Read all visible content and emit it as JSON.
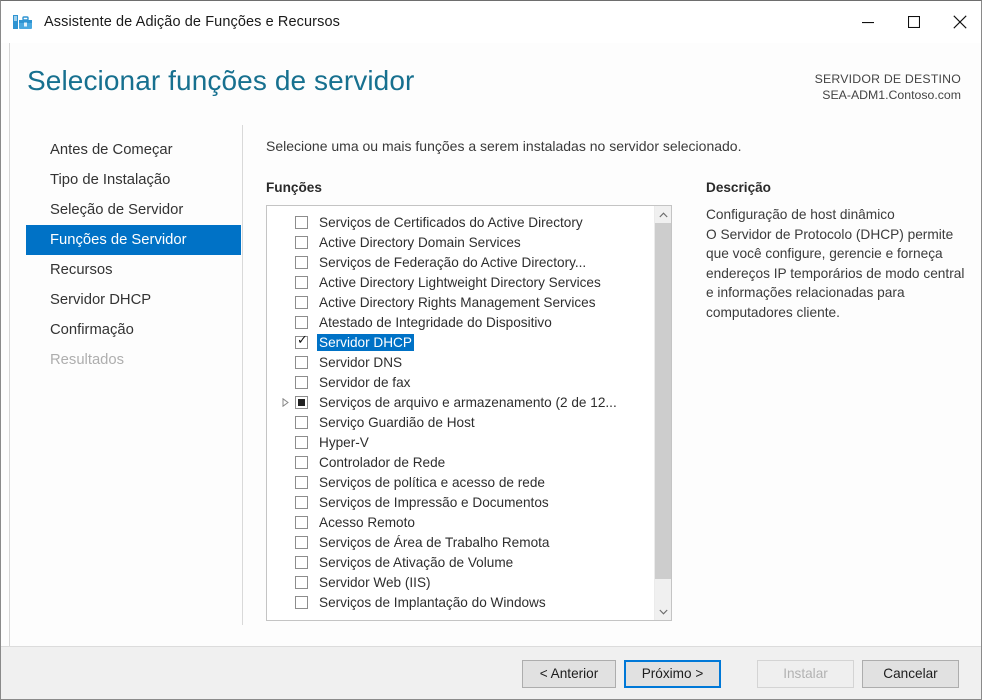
{
  "window": {
    "title": "Assistente de Adição de Funções e Recursos",
    "icon": "server-manager-toolbox-icon",
    "controls": {
      "minimize": "minimize-icon",
      "maximize": "maximize-icon",
      "close": "close-icon"
    }
  },
  "header": {
    "page_title": "Selecionar funções de servidor",
    "target_label": "SERVIDOR DE DESTINO",
    "target_value": "SEA-ADM1.Contoso.com"
  },
  "sidebar": {
    "items": [
      {
        "label": "Antes de Começar",
        "state": "normal"
      },
      {
        "label": "Tipo de Instalação",
        "state": "normal"
      },
      {
        "label": "Seleção de Servidor",
        "state": "normal"
      },
      {
        "label": "Funções de Servidor",
        "state": "selected"
      },
      {
        "label": "Recursos",
        "state": "normal"
      },
      {
        "label": "Servidor DHCP",
        "state": "normal"
      },
      {
        "label": "Confirmação",
        "state": "normal"
      },
      {
        "label": "Resultados",
        "state": "disabled"
      }
    ]
  },
  "main": {
    "instruction": "Selecione uma ou mais funções a serem instaladas no servidor selecionado.",
    "roles_header": "Funções",
    "description_header": "Descrição",
    "description_text": "Configuração de host dinâmico\nO Servidor de Protocolo (DHCP) permite que você configure, gerencie e forneça endereços IP temporários de modo central e informações relacionadas para computadores cliente.",
    "roles": [
      {
        "label": "Serviços de Certificados do Active Directory",
        "checkbox": "unchecked",
        "expandable": false,
        "selected": false
      },
      {
        "label": "Active Directory Domain Services",
        "checkbox": "unchecked",
        "expandable": false,
        "selected": false
      },
      {
        "label": "Serviços de Federação do Active Directory...",
        "checkbox": "unchecked",
        "expandable": false,
        "selected": false
      },
      {
        "label": "Active Directory Lightweight Directory Services",
        "checkbox": "unchecked",
        "expandable": false,
        "selected": false
      },
      {
        "label": "Active Directory Rights Management Services",
        "checkbox": "unchecked",
        "expandable": false,
        "selected": false
      },
      {
        "label": "Atestado de Integridade do Dispositivo",
        "checkbox": "unchecked",
        "expandable": false,
        "selected": false
      },
      {
        "label": "Servidor DHCP",
        "checkbox": "checked",
        "expandable": false,
        "selected": true
      },
      {
        "label": "Servidor DNS",
        "checkbox": "unchecked",
        "expandable": false,
        "selected": false
      },
      {
        "label": "Servidor de fax",
        "checkbox": "unchecked",
        "expandable": false,
        "selected": false
      },
      {
        "label": "Serviços de arquivo e armazenamento (2 de 12...",
        "checkbox": "partial",
        "expandable": true,
        "selected": false
      },
      {
        "label": "Serviço Guardião de Host",
        "checkbox": "unchecked",
        "expandable": false,
        "selected": false
      },
      {
        "label": "Hyper-V",
        "checkbox": "unchecked",
        "expandable": false,
        "selected": false
      },
      {
        "label": "Controlador de Rede",
        "checkbox": "unchecked",
        "expandable": false,
        "selected": false
      },
      {
        "label": "Serviços de política e acesso de rede",
        "checkbox": "unchecked",
        "expandable": false,
        "selected": false
      },
      {
        "label": "Serviços de Impressão e Documentos",
        "checkbox": "unchecked",
        "expandable": false,
        "selected": false
      },
      {
        "label": "Acesso Remoto",
        "checkbox": "unchecked",
        "expandable": false,
        "selected": false
      },
      {
        "label": "Serviços de Área de Trabalho Remota",
        "checkbox": "unchecked",
        "expandable": false,
        "selected": false
      },
      {
        "label": "Serviços de Ativação de Volume",
        "checkbox": "unchecked",
        "expandable": false,
        "selected": false
      },
      {
        "label": "Servidor Web (IIS)",
        "checkbox": "unchecked",
        "expandable": false,
        "selected": false
      },
      {
        "label": "Serviços de Implantação do Windows",
        "checkbox": "unchecked",
        "expandable": false,
        "selected": false
      }
    ],
    "scrollbar": {
      "up_icon": "chevron-up-icon",
      "down_icon": "chevron-down-icon"
    }
  },
  "footer": {
    "previous": "< Anterior",
    "next": "Próximo >",
    "install": "Instalar",
    "cancel": "Cancelar"
  },
  "colors": {
    "accent": "#0072c6",
    "title_teal": "#17708f",
    "footer_bg": "#f0f0f0",
    "selection_blue": "#0072c6"
  }
}
